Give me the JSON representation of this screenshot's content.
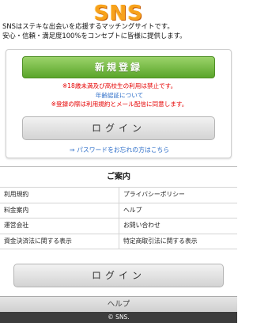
{
  "header": {
    "logo_text": "SNS",
    "intro_line1": "SNSはステキな出会いを応援するマッチングサイトです。",
    "intro_line2": "安心・信頼・満足度100%をコンセプトに皆様に提供します。"
  },
  "panel": {
    "register_label": "新規登録",
    "warning_age": "※18歳未満及び高校生の利用は禁止です。",
    "age_verification_link": "年齢認証について",
    "warning_terms": "※登録の際は利用規約とメール配信に同意します。",
    "login_label": "ログイン",
    "forgot_arrow": "⇒",
    "forgot_label": "パスワードをお忘れの方はこちら"
  },
  "guide": {
    "title": "ご案内",
    "items": [
      [
        "利用規約",
        "プライバシーポリシー"
      ],
      [
        "料金案内",
        "ヘルプ"
      ],
      [
        "運営会社",
        "お問い合わせ"
      ],
      [
        "資金決済法に関する表示",
        "特定商取引法に関する表示"
      ]
    ]
  },
  "bottom": {
    "login_label": "ログイン",
    "help_label": "ヘルプ",
    "copyright": "© SNS."
  },
  "colors": {
    "logo": "#f7a21b",
    "register_button": "#6bb43a",
    "warning": "#e60000",
    "link": "#2f6fc9",
    "footer_bar": "#3c3c3c"
  }
}
